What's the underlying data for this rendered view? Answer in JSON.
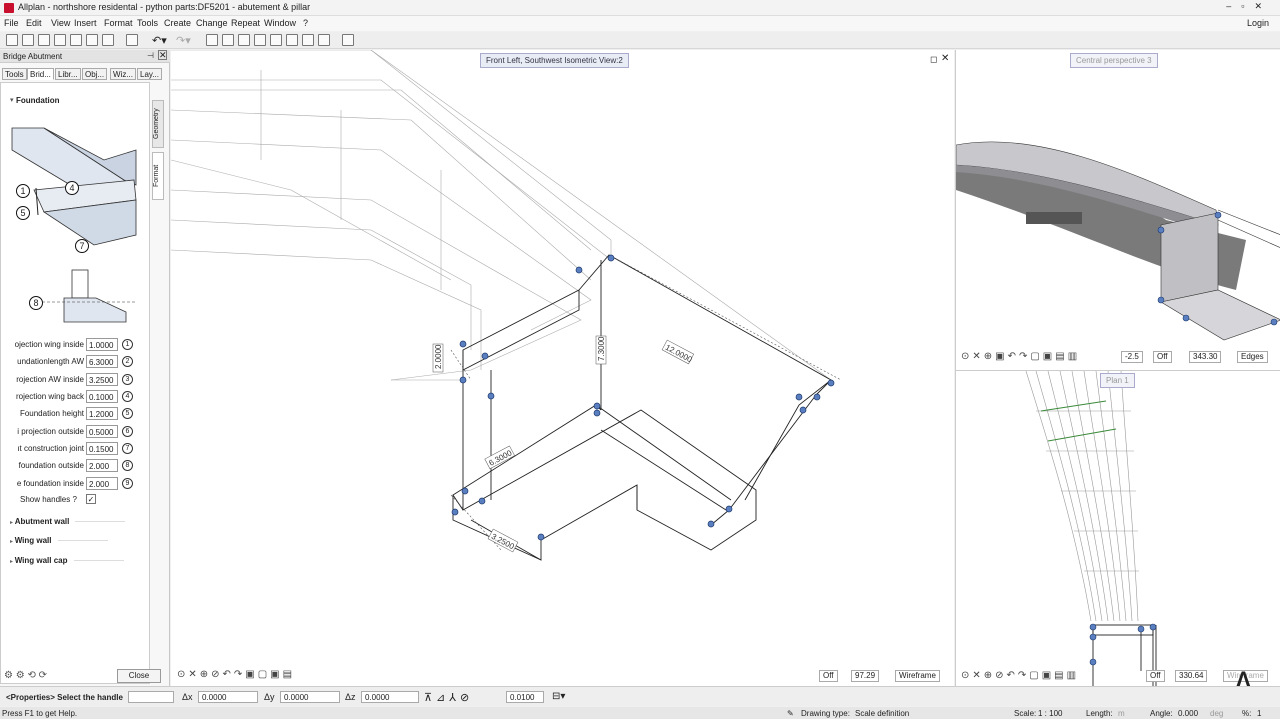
{
  "window": {
    "title": "Allplan - northshore residental - python parts:DF5201 - abutement & pillar",
    "controls": [
      "–",
      "▫",
      "✕"
    ],
    "login": "Login"
  },
  "menu": [
    "File",
    "Edit",
    "View",
    "Insert",
    "Format",
    "Tools",
    "Create",
    "Change",
    "Repeat",
    "Window",
    "?"
  ],
  "panel": {
    "title": "Bridge Abutment",
    "tabs": [
      "Tools",
      "Brid...",
      "Libr...",
      "Obj...",
      "Wiz...",
      "Lay..."
    ],
    "vtabs": [
      "Geometry",
      "Format"
    ],
    "section_open": "Foundation",
    "callouts": [
      "1",
      "4",
      "5",
      "7",
      "8"
    ],
    "params": [
      {
        "label": "ojection wing inside",
        "value": "1.0000",
        "num": "1"
      },
      {
        "label": "undationlength AW",
        "value": "6.3000",
        "num": "2"
      },
      {
        "label": "rojection AW inside",
        "value": "3.2500",
        "num": "3"
      },
      {
        "label": "rojection wing back",
        "value": "0.1000",
        "num": "4"
      },
      {
        "label": "Foundation height",
        "value": "1.2000",
        "num": "5"
      },
      {
        "label": "i projection outside",
        "value": "0.5000",
        "num": "6"
      },
      {
        "label": "ıt construction joint",
        "value": "0.1500",
        "num": "7"
      },
      {
        "label": "foundation outside",
        "value": "2.000",
        "num": "8"
      },
      {
        "label": "e foundation inside",
        "value": "2.000",
        "num": "9"
      }
    ],
    "show_handles_label": "Show handles ?",
    "show_handles_value": "✓",
    "sections": [
      "Abutment wall",
      "Wing wall",
      "Wing wall cap"
    ],
    "close_label": "Close"
  },
  "main_view": {
    "label": "Front Left, Southwest Isometric View:2",
    "dimensions": [
      "2.0000",
      "7.3000",
      "12.0000",
      "6.3000",
      "3.2500"
    ],
    "controls": {
      "off": "Off",
      "value": "97.29",
      "mode": "Wireframe"
    }
  },
  "view_perspective": {
    "label": "Central perspective 3",
    "controls": {
      "angle": "-2.5",
      "off": "Off",
      "value": "343.30",
      "mode": "Edges"
    }
  },
  "view_plan": {
    "label": "Plan 1",
    "controls": {
      "off": "Off",
      "value": "330.64",
      "mode": "Wireframe"
    }
  },
  "coords": {
    "prompt": "<Properties> Select the handle",
    "dx_label": "Δx",
    "dx": "0.0000",
    "dy_label": "Δy",
    "dy": "0.0000",
    "dz_label": "Δz",
    "dz": "0.0000",
    "step": "0.0100"
  },
  "status": {
    "help": "Press F1 to get Help.",
    "drawing_type_label": "Drawing type:",
    "drawing_type": "Scale definition",
    "scale_label": "Scale:",
    "scale": "1 : 100",
    "length_label": "Length:",
    "length_unit": "m",
    "angle_label": "Angle:",
    "angle": "0.000",
    "angle_unit": "deg",
    "percent_label": "%:",
    "percent": "1"
  }
}
